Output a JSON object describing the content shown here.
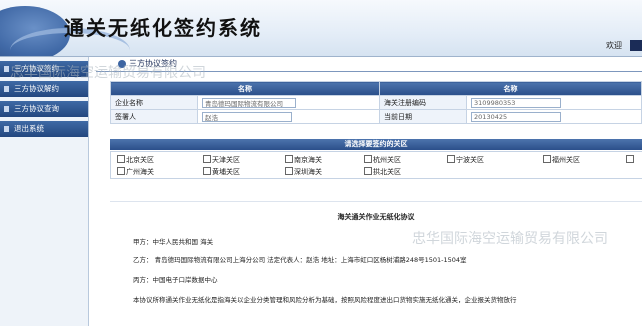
{
  "header": {
    "title": "通关无纸化签约系统",
    "welcome": "欢迎"
  },
  "sidebar": {
    "items": [
      {
        "label": "三方协议签约"
      },
      {
        "label": "三方协议解约"
      },
      {
        "label": "三方协议查询"
      },
      {
        "label": "退出系统"
      }
    ]
  },
  "section": {
    "title": "三方协议签约"
  },
  "info_table": {
    "col1_header": "名称",
    "col2_header": "名称",
    "rows": [
      {
        "label1": "企业名称",
        "value1": "青岛德玛国际物流有限公司",
        "label2": "海关注册编码",
        "value2": "3109980353"
      },
      {
        "label1": "签署人",
        "value1": "赵浩",
        "label2": "当前日期",
        "value2": "20130425"
      }
    ]
  },
  "customs": {
    "header": "请选择要签约的关区",
    "options": [
      "北京关区",
      "天津关区",
      "南京海关",
      "杭州关区",
      "宁波关区",
      "福州关区",
      "",
      "广州海关",
      "黄埔关区",
      "深圳海关",
      "拱北关区"
    ]
  },
  "agreement": {
    "title": "海关通关作业无纸化协议",
    "party_a": "甲方：中华人民共和国    海关",
    "party_b": "乙方：  青岛德玛国际物流有限公司上海分公司      法定代表人：赵浩      地址：上海市虹口区杨树浦路248号1501-1504室",
    "party_c": "丙方：中国电子口岸数据中心",
    "body": "本协议所称通关作业无纸化是指海关以企业分类管理和风险分析为基础，按照风险程度进出口货物实施无纸化通关，企业报关货物放行"
  },
  "watermark": "忠华国际海空运输贸易有限公司"
}
